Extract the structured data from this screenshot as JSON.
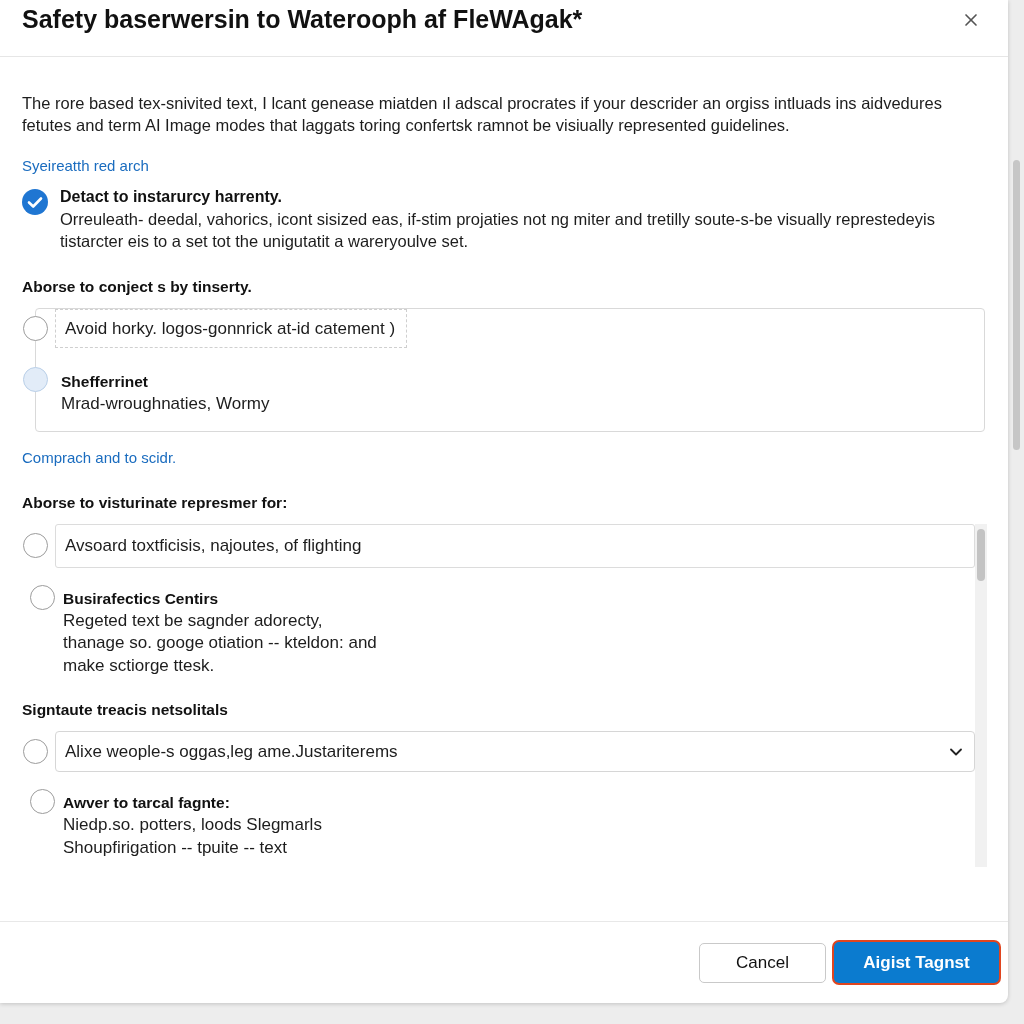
{
  "dialog": {
    "title": "Safety baserwersin to Waterooph af FleWAgak*"
  },
  "body": [
    {
      "kind": "paragraph",
      "lines": [
        "The rore based tex-snivited text, I lcant genease miatden ıl adscal procrates if your descrider an orgiss intluads ins aidvedures",
        "fetutes and term AI Image modes that laggats toring confertsk ramnot be visiually represented guidelines."
      ]
    },
    {
      "kind": "link",
      "text": "Syeireatth red arch"
    },
    {
      "kind": "checkbox",
      "label": "Detact to instarurcy harrenty.",
      "description_lines": [
        "Orreuleath- deedal, vahorics, icont sisized eas, if-stim projaties not ng miter and tretilly soute-s-be visually represtedeyis",
        "tistarcter eis to a set tot the unigutatit a wareryoulve set."
      ],
      "checked": true
    },
    {
      "kind": "heading",
      "text": "Aborse to conject s by tinserty."
    },
    {
      "kind": "option_group",
      "framed": true,
      "options": [
        {
          "kind": "field",
          "text": "Avoid horky. logos-gonnrick at-id catement )",
          "selected": false,
          "highlighted": false
        },
        {
          "kind": "detail",
          "title": "Shefferrinet",
          "description_lines": [
            "Mrad-wroughnaties, Wormy"
          ],
          "selected": false,
          "highlighted": true
        }
      ]
    },
    {
      "kind": "link",
      "text": "Comprach and to scidr."
    },
    {
      "kind": "heading",
      "text": "Aborse to visturinate represmer for:"
    },
    {
      "kind": "scroll_area",
      "blocks": [
        {
          "kind": "option_group",
          "framed": false,
          "options": [
            {
              "kind": "field",
              "text": "Avsoard toxtficisis, najoutes, of flighting",
              "selected": false,
              "highlighted": false
            },
            {
              "kind": "detail",
              "title": "Busirafectics Centirs",
              "description_lines": [
                "Regeted text be sagnder adorecty,",
                "thanage so. googe otiation -- kteldon: and",
                "make sctiorge ttesk."
              ],
              "selected": false,
              "highlighted": false
            }
          ]
        },
        {
          "kind": "heading",
          "text": "Signtaute treacis netsolitals"
        },
        {
          "kind": "option_group",
          "framed": false,
          "options": [
            {
              "kind": "dropdown",
              "text": "Alixe weople-s oggas,leg ame.Justariterems",
              "selected": false,
              "highlighted": false
            },
            {
              "kind": "detail",
              "title": "Awver to tarcal fagnte:",
              "description_lines": [
                "Niedp.so. potters, loods Slegmarls",
                "Shoupfirigation -- tpuite -- text"
              ],
              "selected": false,
              "highlighted": false
            }
          ]
        }
      ]
    }
  ],
  "footer": {
    "buttons": [
      {
        "kind": "secondary",
        "label": "Cancel",
        "focused": false
      },
      {
        "kind": "primary",
        "label": "Aigist Tagnst",
        "focused": true
      }
    ]
  }
}
